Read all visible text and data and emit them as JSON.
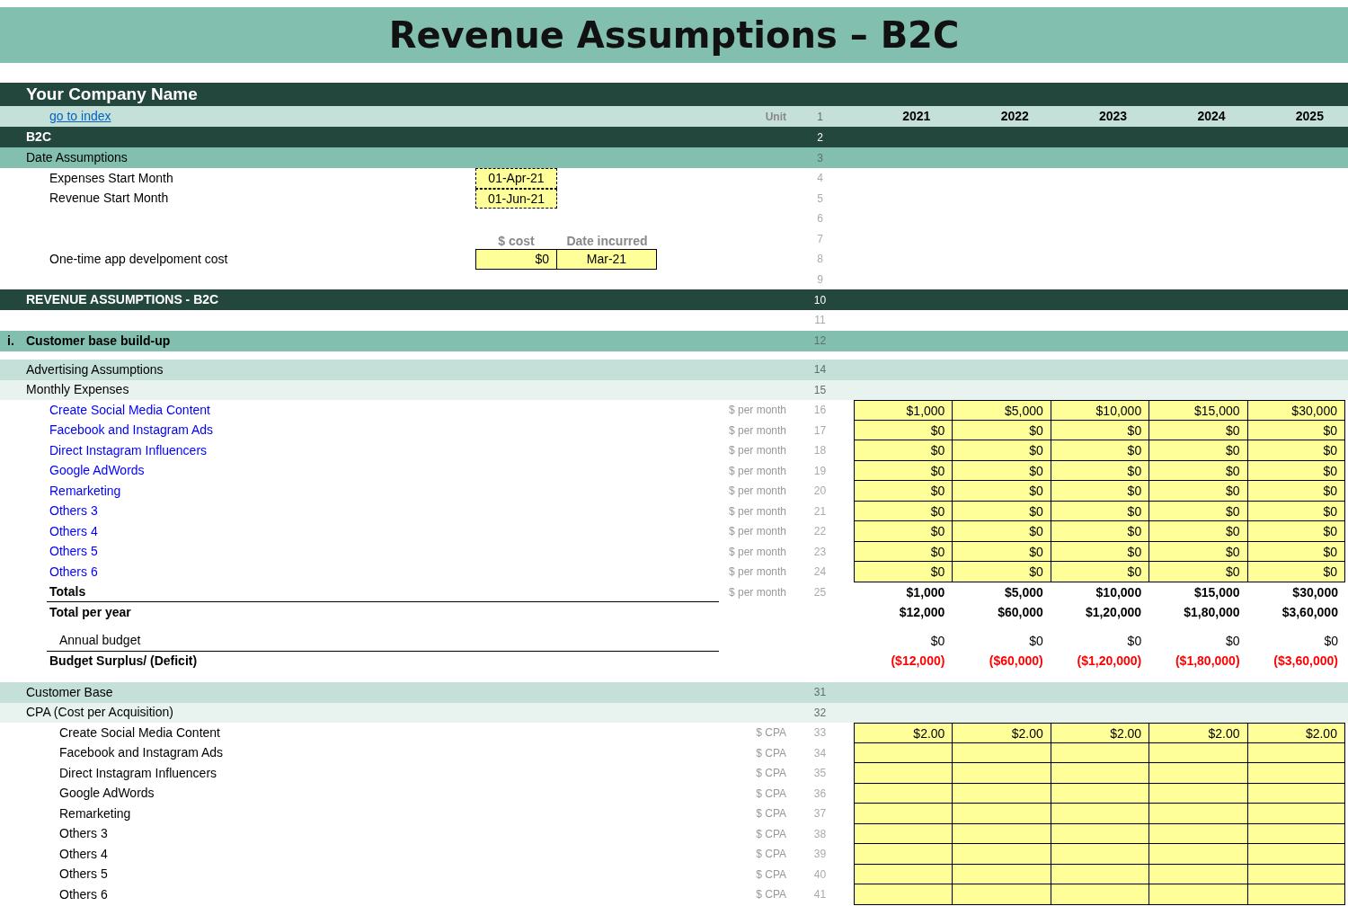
{
  "title": "Revenue Assumptions – B2C",
  "years": [
    "2021",
    "2022",
    "2023",
    "2024",
    "2025"
  ],
  "rows": [
    {
      "kind": "company",
      "label": "Your Company Name"
    },
    {
      "kind": "link",
      "label": "go to index",
      "unit": "Unit",
      "num": "1"
    },
    {
      "kind": "section",
      "label": "B2C",
      "num": "2"
    },
    {
      "kind": "group",
      "label": "Date Assumptions",
      "num": "3"
    },
    {
      "kind": "date",
      "label": "Expenses Start Month",
      "input": "01-Apr-21",
      "num": "4"
    },
    {
      "kind": "date",
      "label": "Revenue Start Month",
      "input": "01-Jun-21",
      "num": "5"
    },
    {
      "kind": "blank",
      "num": "6"
    },
    {
      "kind": "cost-header",
      "headers": [
        "$ cost",
        "Date incurred"
      ],
      "num": "7"
    },
    {
      "kind": "cost",
      "label": "One-time app develpoment cost",
      "inputs": [
        "$0",
        "Mar-21"
      ],
      "num": "8"
    },
    {
      "kind": "blank",
      "num": "9"
    },
    {
      "kind": "section",
      "label": "REVENUE ASSUMPTIONS - B2C",
      "num": "10"
    },
    {
      "kind": "blank",
      "num": "11"
    },
    {
      "kind": "group",
      "marker": "i.",
      "label": "Customer base build-up",
      "num": "12",
      "bold": true
    },
    {
      "kind": "sub",
      "label": "Advertising Assumptions",
      "num": "14"
    },
    {
      "kind": "subsub",
      "label": "Monthly Expenses",
      "num": "15"
    },
    {
      "kind": "expense",
      "label": "Create Social Media Content",
      "unit": "$ per month",
      "num": "16",
      "values": [
        "$1,000",
        "$5,000",
        "$10,000",
        "$15,000",
        "$30,000"
      ]
    },
    {
      "kind": "expense",
      "label": "Facebook and Instagram Ads",
      "unit": "$ per month",
      "num": "17",
      "values": [
        "$0",
        "$0",
        "$0",
        "$0",
        "$0"
      ]
    },
    {
      "kind": "expense",
      "label": "Direct Instagram Influencers",
      "unit": "$ per month",
      "num": "18",
      "values": [
        "$0",
        "$0",
        "$0",
        "$0",
        "$0"
      ]
    },
    {
      "kind": "expense",
      "label": "Google AdWords",
      "unit": "$ per month",
      "num": "19",
      "values": [
        "$0",
        "$0",
        "$0",
        "$0",
        "$0"
      ]
    },
    {
      "kind": "expense",
      "label": "Remarketing",
      "unit": "$ per month",
      "num": "20",
      "values": [
        "$0",
        "$0",
        "$0",
        "$0",
        "$0"
      ]
    },
    {
      "kind": "expense",
      "label": "Others 3",
      "unit": "$ per month",
      "num": "21",
      "values": [
        "$0",
        "$0",
        "$0",
        "$0",
        "$0"
      ]
    },
    {
      "kind": "expense",
      "label": "Others 4",
      "unit": "$ per month",
      "num": "22",
      "values": [
        "$0",
        "$0",
        "$0",
        "$0",
        "$0"
      ]
    },
    {
      "kind": "expense",
      "label": "Others 5",
      "unit": "$ per month",
      "num": "23",
      "values": [
        "$0",
        "$0",
        "$0",
        "$0",
        "$0"
      ]
    },
    {
      "kind": "expense",
      "label": "Others 6",
      "unit": "$ per month",
      "num": "24",
      "values": [
        "$0",
        "$0",
        "$0",
        "$0",
        "$0"
      ]
    },
    {
      "kind": "total",
      "label": "Totals",
      "unit": "$ per month",
      "num": "25",
      "values": [
        "$1,000",
        "$5,000",
        "$10,000",
        "$15,000",
        "$30,000"
      ]
    },
    {
      "kind": "year-total",
      "label": "Total per year",
      "values": [
        "$12,000",
        "$60,000",
        "$1,20,000",
        "$1,80,000",
        "$3,60,000"
      ]
    },
    {
      "kind": "budget",
      "label": "Annual budget",
      "values": [
        "$0",
        "$0",
        "$0",
        "$0",
        "$0"
      ]
    },
    {
      "kind": "deficit",
      "label": "Budget Surplus/ (Deficit)",
      "values": [
        "($12,000)",
        "($60,000)",
        "($1,20,000)",
        "($1,80,000)",
        "($3,60,000)"
      ]
    },
    {
      "kind": "sub",
      "label": "Customer Base",
      "num": "31"
    },
    {
      "kind": "subsub",
      "label": "CPA (Cost per Acquisition)",
      "num": "32"
    },
    {
      "kind": "cpa",
      "label": "Create Social Media Content",
      "unit": "$ CPA",
      "num": "33",
      "values": [
        "$2.00",
        "$2.00",
        "$2.00",
        "$2.00",
        "$2.00"
      ]
    },
    {
      "kind": "cpa",
      "label": "Facebook and Instagram Ads",
      "unit": "$ CPA",
      "num": "34"
    },
    {
      "kind": "cpa",
      "label": "Direct Instagram Influencers",
      "unit": "$ CPA",
      "num": "35"
    },
    {
      "kind": "cpa",
      "label": "Google AdWords",
      "unit": "$ CPA",
      "num": "36"
    },
    {
      "kind": "cpa",
      "label": "Remarketing",
      "unit": "$ CPA",
      "num": "37"
    },
    {
      "kind": "cpa",
      "label": "Others 3",
      "unit": "$ CPA",
      "num": "38"
    },
    {
      "kind": "cpa",
      "label": "Others 4",
      "unit": "$ CPA",
      "num": "39"
    },
    {
      "kind": "cpa",
      "label": "Others 5",
      "unit": "$ CPA",
      "num": "40"
    },
    {
      "kind": "cpa",
      "label": "Others 6",
      "unit": "$ CPA",
      "num": "41"
    }
  ]
}
